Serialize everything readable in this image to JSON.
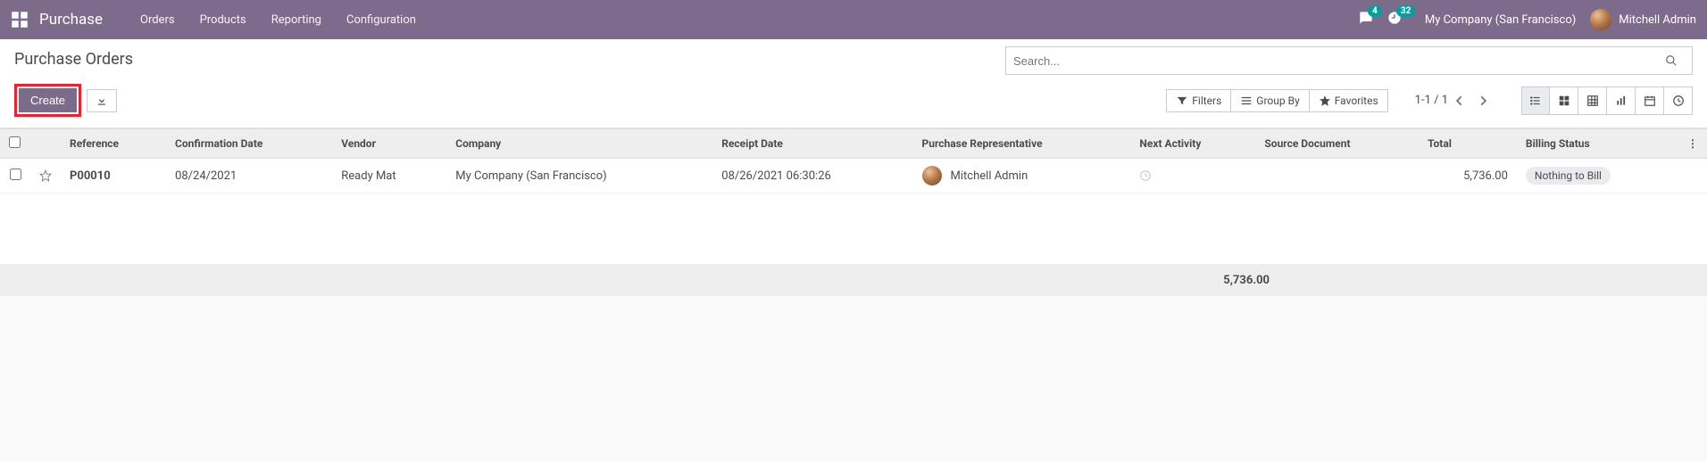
{
  "topbar": {
    "app_name": "Purchase",
    "nav": [
      "Orders",
      "Products",
      "Reporting",
      "Configuration"
    ],
    "messages_badge": "4",
    "activities_badge": "32",
    "company": "My Company (San Francisco)",
    "user": "Mitchell Admin"
  },
  "breadcrumb": {
    "title": "Purchase Orders"
  },
  "controls": {
    "create_label": "Create",
    "search_placeholder": "Search...",
    "filters_label": "Filters",
    "groupby_label": "Group By",
    "favorites_label": "Favorites",
    "pager": "1-1 / 1"
  },
  "table": {
    "headers": {
      "reference": "Reference",
      "confirmation_date": "Confirmation Date",
      "vendor": "Vendor",
      "company": "Company",
      "receipt_date": "Receipt Date",
      "purchase_rep": "Purchase Representative",
      "next_activity": "Next Activity",
      "source_document": "Source Document",
      "total": "Total",
      "billing_status": "Billing Status"
    },
    "rows": [
      {
        "reference": "P00010",
        "confirmation_date": "08/24/2021",
        "vendor": "Ready Mat",
        "company": "My Company (San Francisco)",
        "receipt_date": "08/26/2021 06:30:26",
        "purchase_rep": "Mitchell Admin",
        "total": "5,736.00",
        "billing_status": "Nothing to Bill"
      }
    ],
    "footer_total": "5,736.00"
  }
}
